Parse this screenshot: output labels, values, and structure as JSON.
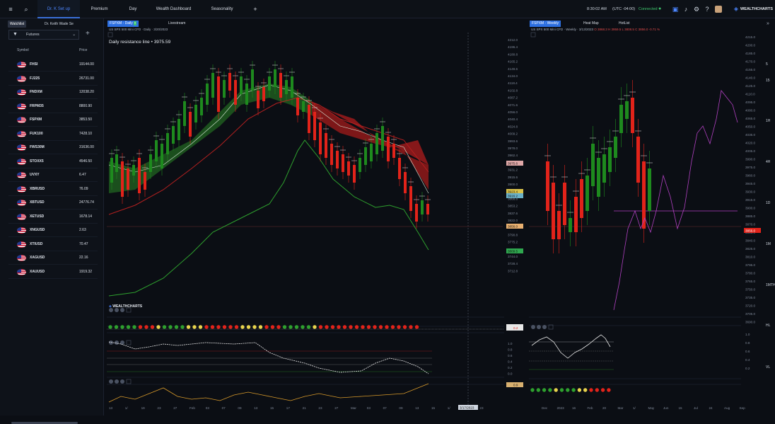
{
  "topbar": {
    "tabs": [
      {
        "label": "Dr. K Set up",
        "active": true
      },
      {
        "label": "Premium"
      },
      {
        "label": "Day"
      },
      {
        "label": "Wealth Dashboard"
      },
      {
        "label": "Seasonality"
      }
    ],
    "add_tab": "+",
    "time": "8:30:02 AM",
    "timezone": "(UTC -04:00)",
    "status": "Connected",
    "logo": "WEALTHCHARTS"
  },
  "sidebar": {
    "tabs": [
      "Watchlist",
      "Dr. Keith Wade Se"
    ],
    "list_select": "Futures",
    "add": "+",
    "col_symbol": "Symbol",
    "col_price": "Price",
    "rows": [
      {
        "sym": "FHSI",
        "price": "19144.00"
      },
      {
        "sym": "FJ225",
        "price": "26731.00"
      },
      {
        "sym": "FNDXM",
        "price": "12038.20"
      },
      {
        "sym": "FRPM35",
        "price": "8800.90"
      },
      {
        "sym": "FSPXM",
        "price": "3853.50"
      },
      {
        "sym": "FUK100",
        "price": "7428.10"
      },
      {
        "sym": "FWS30M",
        "price": "31636.00"
      },
      {
        "sym": "STOXX5",
        "price": "4546.50"
      },
      {
        "sym": "UVXY",
        "price": "6.47"
      },
      {
        "sym": "XBRUSD",
        "price": "76.09"
      },
      {
        "sym": "XBTUSD",
        "price": "24776.74"
      },
      {
        "sym": "XETUSD",
        "price": "1678.14"
      },
      {
        "sym": "XNGUSD",
        "price": "2.63"
      },
      {
        "sym": "XTIUSD",
        "price": "70.47"
      },
      {
        "sym": "XAGUSD",
        "price": "22.16"
      },
      {
        "sym": "XAUUSD",
        "price": "1919.32"
      }
    ]
  },
  "left_chart": {
    "tabs": [
      "FSPXM - Daily",
      "Livestream"
    ],
    "symbol_line": "US SPX 500 Mini CFD · Daily · 3/20/2023",
    "annotation": "Daily resistance line • 3975.59",
    "logo": "WEALTHCHARTS",
    "price_axis": [
      "4212.0",
      "4196.4",
      "4180.8",
      "4165.2",
      "4149.6",
      "4134.0",
      "4118.4",
      "4102.8",
      "4087.2",
      "4071.6",
      "4056.0",
      "4040.4",
      "4024.8",
      "4009.2",
      "3993.6",
      "3978.0",
      "3962.4",
      "3946.8",
      "3931.2",
      "3915.6",
      "3900.0",
      "3884.4",
      "3868.8",
      "3853.2",
      "3837.6",
      "3822.0",
      "3806.4",
      "3790.8",
      "3775.2",
      "3759.6",
      "3744.0",
      "3728.4",
      "3712.8"
    ],
    "price_labels": [
      {
        "text": "3975.6",
        "color": "#e0a8a8"
      },
      {
        "text": "3923.4",
        "color": "#d9c24a"
      },
      {
        "text": "3916.2",
        "color": "#6ab0c8"
      },
      {
        "text": "3856.0",
        "color": "#e8b070"
      },
      {
        "text": "3809.5",
        "color": "#2fa84f"
      }
    ],
    "date_axis": [
      "13",
      "1/",
      "19",
      "23",
      "27",
      "Feb",
      "03",
      "07",
      "09",
      "13",
      "15",
      "17",
      "21",
      "23",
      "27",
      "Mar",
      "03",
      "07",
      "09",
      "13",
      "15",
      "1/",
      "21",
      "23"
    ],
    "current_date": "3/17/2023",
    "osc1_axis": [
      "1.0",
      "0.8",
      "0.6",
      "0.4",
      "0.2",
      "0.0"
    ],
    "osc1_tag": "0.2",
    "osc2_axis": [
      "1.0",
      "0.8",
      "0.6",
      "0.4",
      "0.2",
      "0.0"
    ],
    "osc3_tag": "0.9"
  },
  "right_chart": {
    "tabs": [
      "FSPXM - Weekly",
      "Heat Map",
      "HotList"
    ],
    "symbol_line": "US SPX 500 Mini CFD · Weekly · 3/13/2023",
    "ohlc": "O 3868.3 H 3959.5 L 3808.5 C 3856.0 -0.71 %",
    "price_axis": [
      "4215.0",
      "4200.0",
      "4185.0",
      "4170.0",
      "4155.0",
      "4140.0",
      "4125.0",
      "4110.0",
      "4095.0",
      "4080.0",
      "4065.0",
      "4050.0",
      "4035.0",
      "4020.0",
      "4005.0",
      "3990.0",
      "3975.0",
      "3960.0",
      "3945.0",
      "3930.0",
      "3915.0",
      "3900.0",
      "3885.0",
      "3870.0",
      "3855.0",
      "3840.0",
      "3825.0",
      "3810.0",
      "3795.0",
      "3780.0",
      "3765.0",
      "3750.0",
      "3735.0",
      "3720.0",
      "3705.0",
      "3690.0"
    ],
    "price_tag": "3856.0",
    "date_axis": [
      "Dec",
      "2023",
      "16",
      "Feb",
      "20",
      "Mar",
      "1/",
      "May",
      "Jun",
      "15",
      "Jul",
      "24",
      "Aug",
      "Sep"
    ],
    "osc_axis": [
      "1.0",
      "0.8",
      "0.6",
      "0.4",
      "0.2"
    ],
    "timeframes": [
      "5",
      "15",
      "1H",
      "4H",
      "1D",
      "1M",
      "1MTH",
      "HL",
      "VL"
    ]
  }
}
